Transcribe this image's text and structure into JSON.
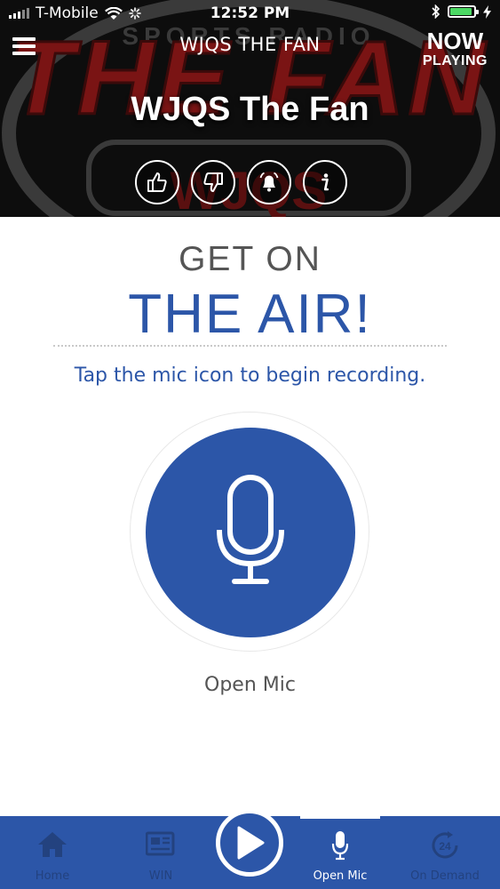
{
  "status_bar": {
    "carrier": "T-Mobile",
    "time": "12:52 PM",
    "battery_level": 0.85
  },
  "header": {
    "station_name": "WJQS THE FAN",
    "now_playing_line1": "NOW",
    "now_playing_line2": "PLAYING",
    "title": "WJQS The Fan",
    "background_logo_text": "THE FAN",
    "actions": [
      "thumbs-up-icon",
      "thumbs-down-icon",
      "bell-icon",
      "info-icon"
    ]
  },
  "main": {
    "heading_line1": "GET ON",
    "heading_line2": "THE AIR!",
    "instruction": "Tap the mic icon to begin recording.",
    "mic_label": "Open Mic"
  },
  "tabbar": {
    "tabs": [
      {
        "label": "Home",
        "icon": "home-icon"
      },
      {
        "label": "WIN",
        "icon": "newspaper-icon"
      },
      {
        "label": "Open Mic",
        "icon": "mic-icon"
      },
      {
        "label": "On Demand",
        "icon": "clock-24-icon"
      }
    ],
    "play_icon": "play-icon"
  },
  "colors": {
    "accent": "#2c56a8",
    "header_bg": "#0d0d0d",
    "logo_red": "#7a1414"
  }
}
